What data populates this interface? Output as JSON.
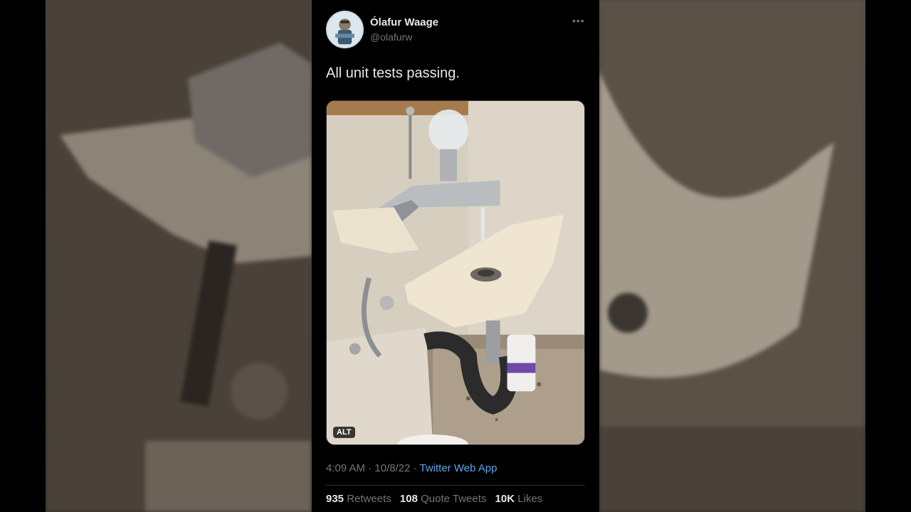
{
  "tweet": {
    "author_name": "Ólafur Waage",
    "author_handle": "@olafurw",
    "more_icon": "more-horizontal-icon",
    "text": "All unit tests passing.",
    "media": {
      "alt_badge": "ALT"
    },
    "time": "4:09 AM",
    "date": "10/8/22",
    "separator": "·",
    "source": "Twitter Web App",
    "stats": {
      "retweets_count": "935",
      "retweets_label": "Retweets",
      "quotes_count": "108",
      "quotes_label": "Quote Tweets",
      "likes_count": "10K",
      "likes_label": "Likes"
    }
  },
  "colors": {
    "background": "#000000",
    "text_primary": "#e7e9ea",
    "text_secondary": "#71767b",
    "link": "#5fa5ea"
  }
}
